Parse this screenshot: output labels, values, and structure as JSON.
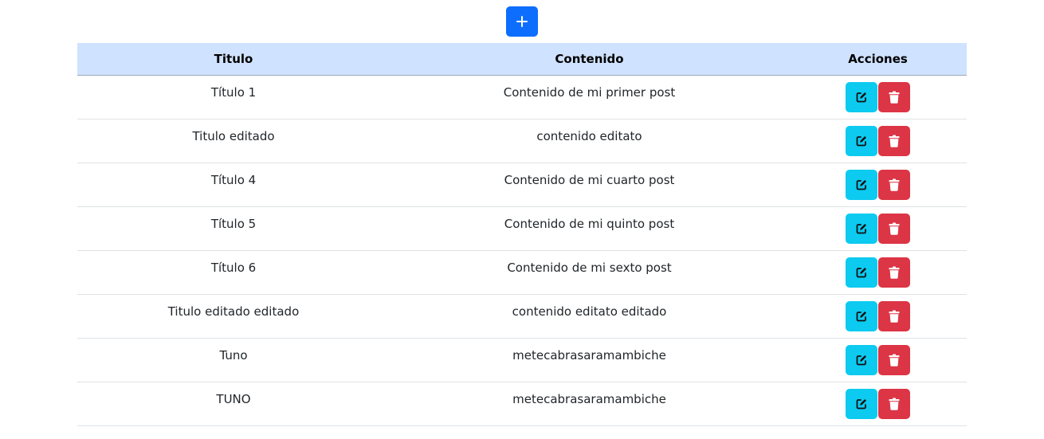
{
  "toolbar": {
    "add_label": "+"
  },
  "table": {
    "headers": [
      "Titulo",
      "Contenido",
      "Acciones"
    ],
    "rows": [
      {
        "titulo": "Título 1",
        "contenido": "Contenido de mi primer post"
      },
      {
        "titulo": "Titulo editado",
        "contenido": "contenido editato"
      },
      {
        "titulo": "Título 4",
        "contenido": "Contenido de mi cuarto post"
      },
      {
        "titulo": "Título 5",
        "contenido": "Contenido de mi quinto post"
      },
      {
        "titulo": "Título 6",
        "contenido": "Contenido de mi sexto post"
      },
      {
        "titulo": "Titulo editado editado",
        "contenido": "contenido editato editado"
      },
      {
        "titulo": "Tuno",
        "contenido": "metecabrasaramambiche"
      },
      {
        "titulo": "TUNO",
        "contenido": "metecabrasaramambiche"
      }
    ]
  },
  "icons": {
    "edit": "edit-icon",
    "delete": "trash-icon"
  },
  "colors": {
    "primary": "#0d6efd",
    "info": "#0dcaf0",
    "danger": "#dc3545",
    "header_bg": "#cfe2ff"
  }
}
